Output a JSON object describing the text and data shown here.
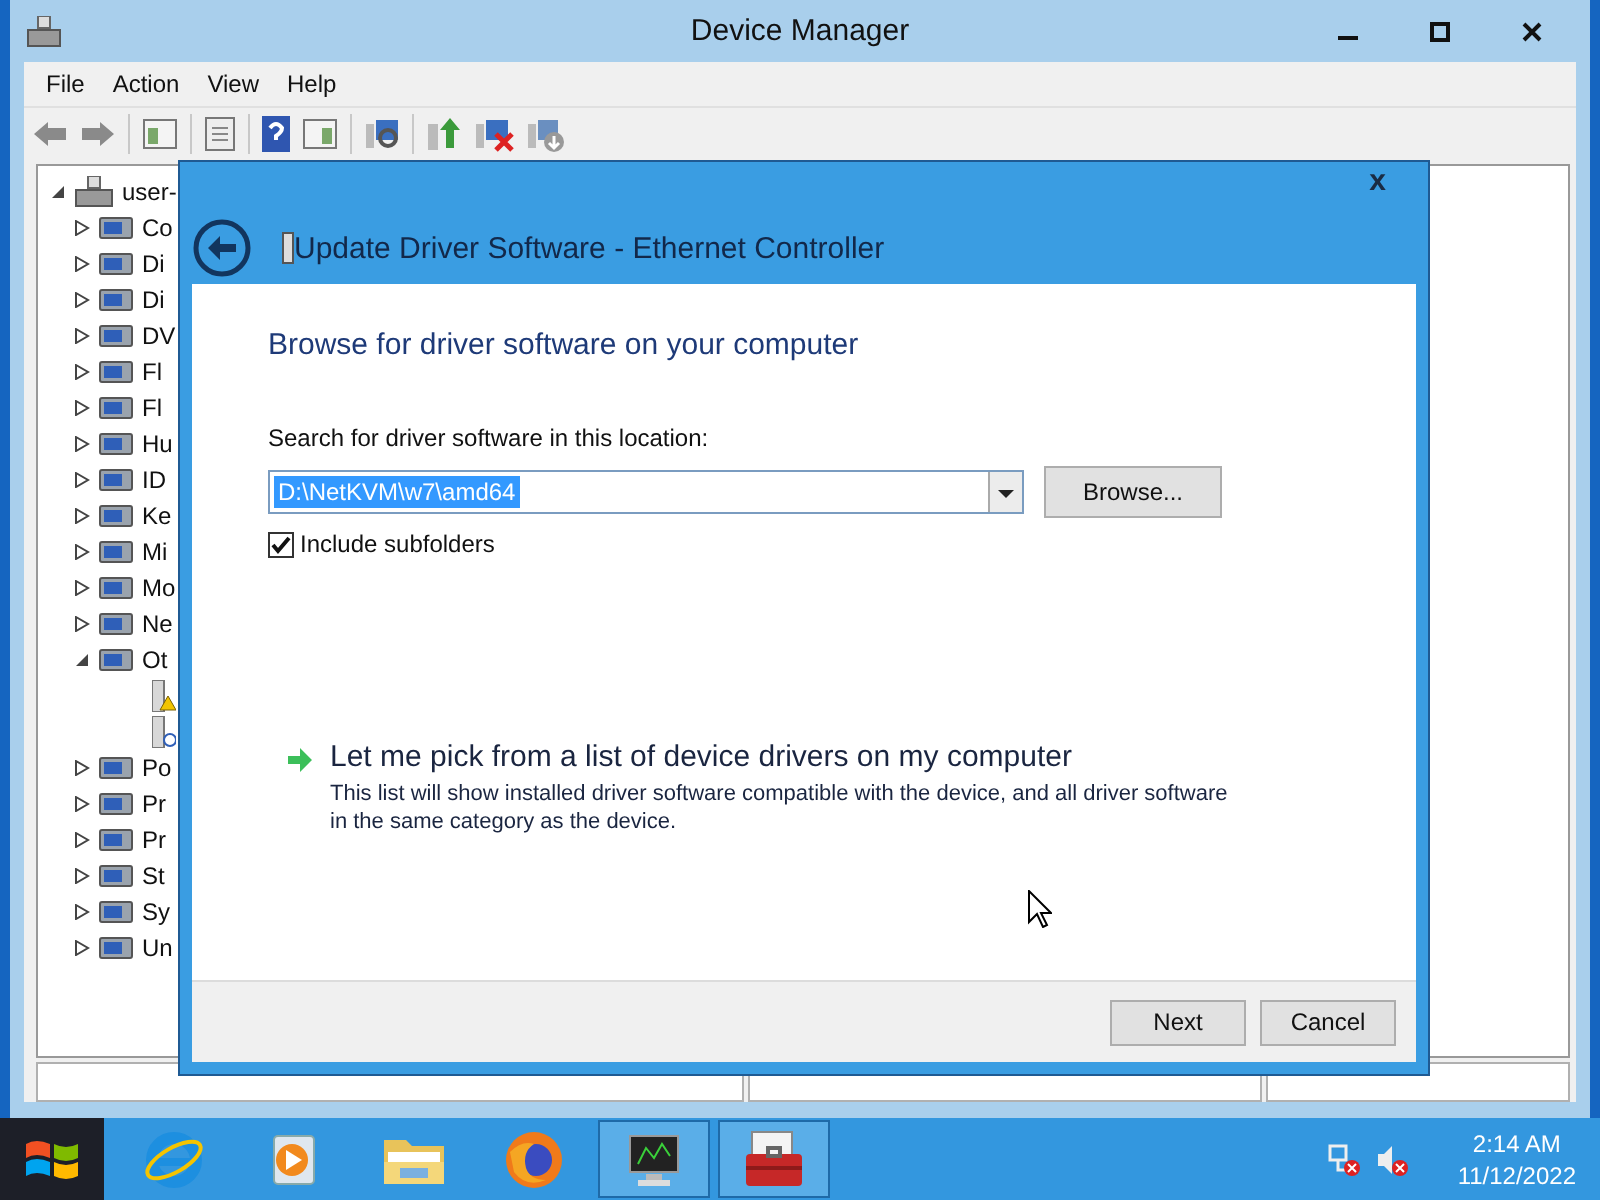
{
  "window": {
    "title": "Device Manager"
  },
  "menu": [
    "File",
    "Action",
    "View",
    "Help"
  ],
  "tree": {
    "label": "user-",
    "expanded": true,
    "children": [
      {
        "label": "Co",
        "expanded": false
      },
      {
        "label": "Di",
        "expanded": false
      },
      {
        "label": "Di",
        "expanded": false
      },
      {
        "label": "DV",
        "expanded": false
      },
      {
        "label": "Fl",
        "expanded": false
      },
      {
        "label": "Fl",
        "expanded": false
      },
      {
        "label": "Hu",
        "expanded": false
      },
      {
        "label": "ID",
        "expanded": false
      },
      {
        "label": "Ke",
        "expanded": false
      },
      {
        "label": "Mi",
        "expanded": false
      },
      {
        "label": "Mo",
        "expanded": false
      },
      {
        "label": "Ne",
        "expanded": false
      },
      {
        "label": "Ot",
        "expanded": true,
        "children": [
          {
            "kind": "warning"
          },
          {
            "kind": "unknown"
          }
        ]
      },
      {
        "label": "Po",
        "expanded": false
      },
      {
        "label": "Pr",
        "expanded": false
      },
      {
        "label": "Pr",
        "expanded": false
      },
      {
        "label": "St",
        "expanded": false
      },
      {
        "label": "Sy",
        "expanded": false
      },
      {
        "label": "Un",
        "expanded": false
      }
    ]
  },
  "dialog": {
    "close": "x",
    "title": "Update Driver Software - Ethernet Controller",
    "heading": "Browse for driver software on your computer",
    "location_label": "Search for driver software in this location:",
    "location": {
      "value": "D:\\NetKVM\\w7\\amd64",
      "selected": true
    },
    "browse_button": "Browse...",
    "include_subfolders": {
      "label": "Include subfolders",
      "checked": true
    },
    "pick_option": {
      "title": "Let me pick from a list of device drivers on my computer",
      "description": "This list will show installed driver software compatible with the device, and all driver software in the same category as the device."
    },
    "buttons": [
      "Next",
      "Cancel"
    ]
  },
  "taskbar": {
    "apps": [
      {
        "kind": "browser-e",
        "selected": false
      },
      {
        "kind": "player",
        "selected": false
      },
      {
        "kind": "folder",
        "selected": false
      },
      {
        "kind": "browser-fox",
        "selected": false
      },
      {
        "kind": "monitor",
        "selected": true
      },
      {
        "kind": "toolbox",
        "selected": true
      }
    ],
    "time": "2:14 AM",
    "date": "11/12/2022"
  }
}
